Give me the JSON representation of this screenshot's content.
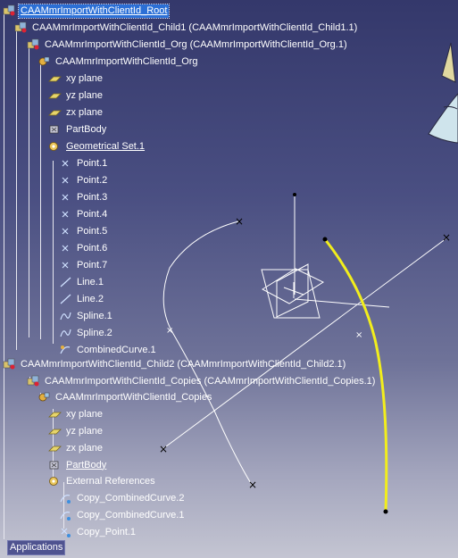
{
  "colors": {
    "selection": "#2b6fd6",
    "curve_highlight": "#f2ee1c",
    "geometry_white": "#ffffff",
    "tree_line": "#e8e8f0"
  },
  "tree": {
    "nodes": [
      {
        "id": "root",
        "label": "CAAMmrImportWithClientId_Root",
        "icon": "product-icon",
        "selected": true
      },
      {
        "id": "child1",
        "label": "CAAMmrImportWithClientId_Child1 (CAAMmrImportWithClientId_Child1.1)",
        "icon": "product-icon"
      },
      {
        "id": "org-instance",
        "label": "CAAMmrImportWithClientId_Org (CAAMmrImportWithClientId_Org.1)",
        "icon": "product-icon"
      },
      {
        "id": "org-part",
        "label": "CAAMmrImportWithClientId_Org",
        "icon": "part-icon"
      },
      {
        "id": "xy1",
        "label": "xy plane",
        "icon": "plane-icon"
      },
      {
        "id": "yz1",
        "label": "yz plane",
        "icon": "plane-icon"
      },
      {
        "id": "zx1",
        "label": "zx plane",
        "icon": "plane-icon"
      },
      {
        "id": "partbody1",
        "label": "PartBody",
        "icon": "partbody-icon"
      },
      {
        "id": "geoset1",
        "label": "Geometrical Set.1",
        "icon": "geometrical-set-icon",
        "underline": true
      },
      {
        "id": "p1",
        "label": "Point.1",
        "icon": "point-icon"
      },
      {
        "id": "p2",
        "label": "Point.2",
        "icon": "point-icon"
      },
      {
        "id": "p3",
        "label": "Point.3",
        "icon": "point-icon"
      },
      {
        "id": "p4",
        "label": "Point.4",
        "icon": "point-icon"
      },
      {
        "id": "p5",
        "label": "Point.5",
        "icon": "point-icon"
      },
      {
        "id": "p6",
        "label": "Point.6",
        "icon": "point-icon"
      },
      {
        "id": "p7",
        "label": "Point.7",
        "icon": "point-icon"
      },
      {
        "id": "l1",
        "label": "Line.1",
        "icon": "line-icon"
      },
      {
        "id": "l2",
        "label": "Line.2",
        "icon": "line-icon"
      },
      {
        "id": "s1",
        "label": "Spline.1",
        "icon": "spline-icon"
      },
      {
        "id": "s2",
        "label": "Spline.2",
        "icon": "spline-icon"
      },
      {
        "id": "cc1",
        "label": "CombinedCurve.1",
        "icon": "combined-curve-icon"
      },
      {
        "id": "child2",
        "label": "CAAMmrImportWithClientId_Child2 (CAAMmrImportWithClientId_Child2.1)",
        "icon": "product-icon"
      },
      {
        "id": "copies-instance",
        "label": "CAAMmrImportWithClientId_Copies (CAAMmrImportWithClientId_Copies.1)",
        "icon": "product-icon"
      },
      {
        "id": "copies-part",
        "label": "CAAMmrImportWithClientId_Copies",
        "icon": "part-icon"
      },
      {
        "id": "xy2",
        "label": "xy plane",
        "icon": "plane-icon"
      },
      {
        "id": "yz2",
        "label": "yz plane",
        "icon": "plane-icon"
      },
      {
        "id": "zx2",
        "label": "zx plane",
        "icon": "plane-icon"
      },
      {
        "id": "partbody2",
        "label": "PartBody",
        "icon": "partbody-icon",
        "underline": true
      },
      {
        "id": "extref",
        "label": "External References",
        "icon": "geometrical-set-icon"
      },
      {
        "id": "copy-cc2",
        "label": "Copy_CombinedCurve.2",
        "icon": "copy-curve-icon"
      },
      {
        "id": "copy-cc1",
        "label": "Copy_CombinedCurve.1",
        "icon": "copy-curve-icon"
      },
      {
        "id": "copy-p1",
        "label": "Copy_Point.1",
        "icon": "copy-point-icon"
      },
      {
        "id": "apps",
        "label": "Applications",
        "icon": "none"
      }
    ]
  }
}
